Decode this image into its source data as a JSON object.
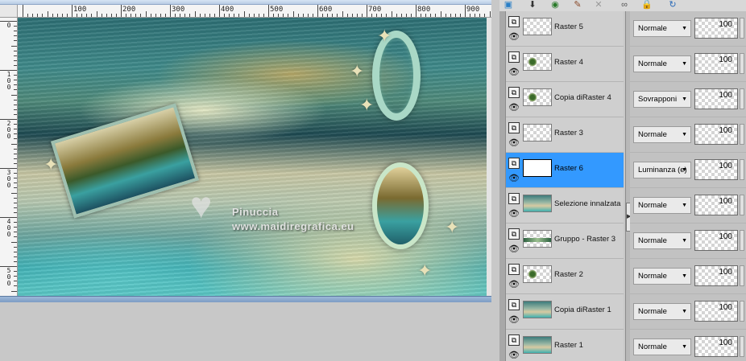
{
  "ruler": {
    "h_labels": [
      "100",
      "200",
      "300",
      "400",
      "500",
      "600",
      "700",
      "800",
      "900"
    ],
    "v_labels": [
      "0",
      "100",
      "200",
      "300",
      "400",
      "500"
    ]
  },
  "watermark": {
    "name": "Pinuccia",
    "url": "www.maidiregrafica.eu"
  },
  "layers_toolbar": {
    "icons": [
      "layer-mask-icon",
      "merge-down-icon",
      "visibility-icon",
      "paint-icon",
      "delete-icon",
      "link-icon",
      "lock-icon",
      "refresh-icon"
    ]
  },
  "layers": [
    {
      "name": "Raster 5",
      "blend": "Normale",
      "opacity": "100",
      "thumb": "empty",
      "selected": false
    },
    {
      "name": "Raster 4",
      "blend": "Normale",
      "opacity": "100",
      "thumb": "speck",
      "selected": false
    },
    {
      "name": "Copia diRaster 4",
      "blend": "Sovrapponi",
      "opacity": "100",
      "thumb": "speck",
      "selected": false
    },
    {
      "name": "Raster 3",
      "blend": "Normale",
      "opacity": "100",
      "thumb": "empty",
      "selected": false
    },
    {
      "name": "Raster 6",
      "blend": "Luminanza (e)",
      "opacity": "100",
      "thumb": "white",
      "selected": true
    },
    {
      "name": "Selezione innalzata",
      "blend": "Normale",
      "opacity": "100",
      "thumb": "scene",
      "selected": false
    },
    {
      "name": "Gruppo - Raster 3",
      "blend": "Normale",
      "opacity": "100",
      "thumb": "band",
      "selected": false
    },
    {
      "name": "Raster 2",
      "blend": "Normale",
      "opacity": "100",
      "thumb": "speck",
      "selected": false
    },
    {
      "name": "Copia diRaster 1",
      "blend": "Normale",
      "opacity": "100",
      "thumb": "scene",
      "selected": false
    },
    {
      "name": "Raster 1",
      "blend": "Normale",
      "opacity": "100",
      "thumb": "scene",
      "selected": false
    }
  ]
}
